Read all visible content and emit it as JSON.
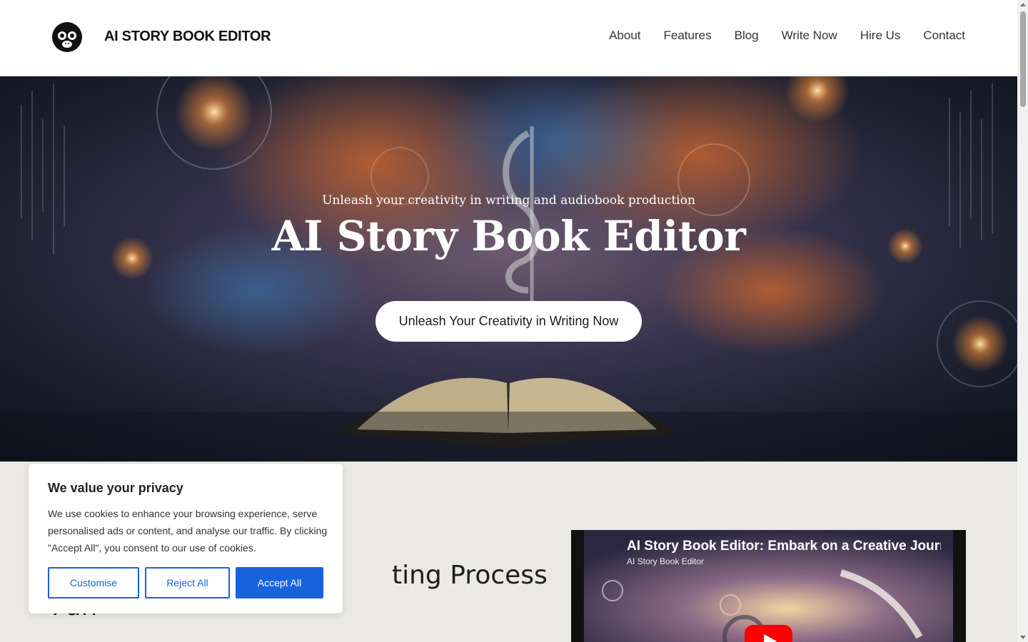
{
  "header": {
    "brand": "AI STORY BOOK EDITOR",
    "logo_icon": "monkey-logo-icon",
    "nav": [
      "About",
      "Features",
      "Blog",
      "Write Now",
      "Hire Us",
      "Contact"
    ]
  },
  "hero": {
    "subtitle": "Unleash your creativity in writing and audiobook production",
    "title": "AI Story Book Editor",
    "cta": "Unleash Your Creativity in Writing Now"
  },
  "section": {
    "heading_line1": "ting Process",
    "heading_line2": "Fun"
  },
  "video": {
    "title": "AI Story Book Editor: Embark on a Creative Journ",
    "channel": "AI Story Book Editor",
    "play_icon": "youtube-play-icon"
  },
  "cookie": {
    "title": "We value your privacy",
    "text": "We use cookies to enhance your browsing experience, serve personalised ads or content, and analyse our traffic. By clicking \"Accept All\", you consent to our use of cookies.",
    "customise": "Customise",
    "reject": "Reject All",
    "accept": "Accept All"
  },
  "colors": {
    "accent": "#1863dc",
    "header_bg": "#ffffff",
    "section_bg": "#ebe9e6",
    "youtube_red": "#ff0000"
  }
}
